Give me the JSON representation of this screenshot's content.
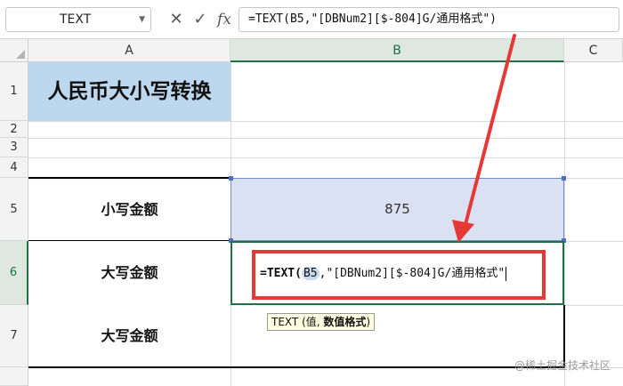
{
  "formula_bar": {
    "name_box": "TEXT",
    "cancel_icon": "✕",
    "confirm_icon": "✓",
    "fx_label": "fx",
    "formula": "=TEXT(B5,\"[DBNum2][$-804]G/通用格式\")"
  },
  "columns": [
    "A",
    "B",
    "C"
  ],
  "rows": [
    "1",
    "2",
    "3",
    "4",
    "5",
    "6",
    "7"
  ],
  "cells": {
    "A1": "人民币大小写转换",
    "A5": "小写金额",
    "A6": "大写金额",
    "A7": "大写金额",
    "B5": "875"
  },
  "editor": {
    "prefix": "=TEXT(",
    "ref": "B5",
    "suffix": ",\"[DBNum2][$-804]G/通用格式\""
  },
  "tooltip": {
    "func": "TEXT (值, ",
    "arg": "数值格式",
    "close": ")"
  },
  "watermark": "@稀土掘金技术社区",
  "colors": {
    "title_fill": "#bdd7ee",
    "input_fill": "#d9e1f2",
    "active_green": "#1e7145",
    "highlight_red": "#e53935"
  }
}
